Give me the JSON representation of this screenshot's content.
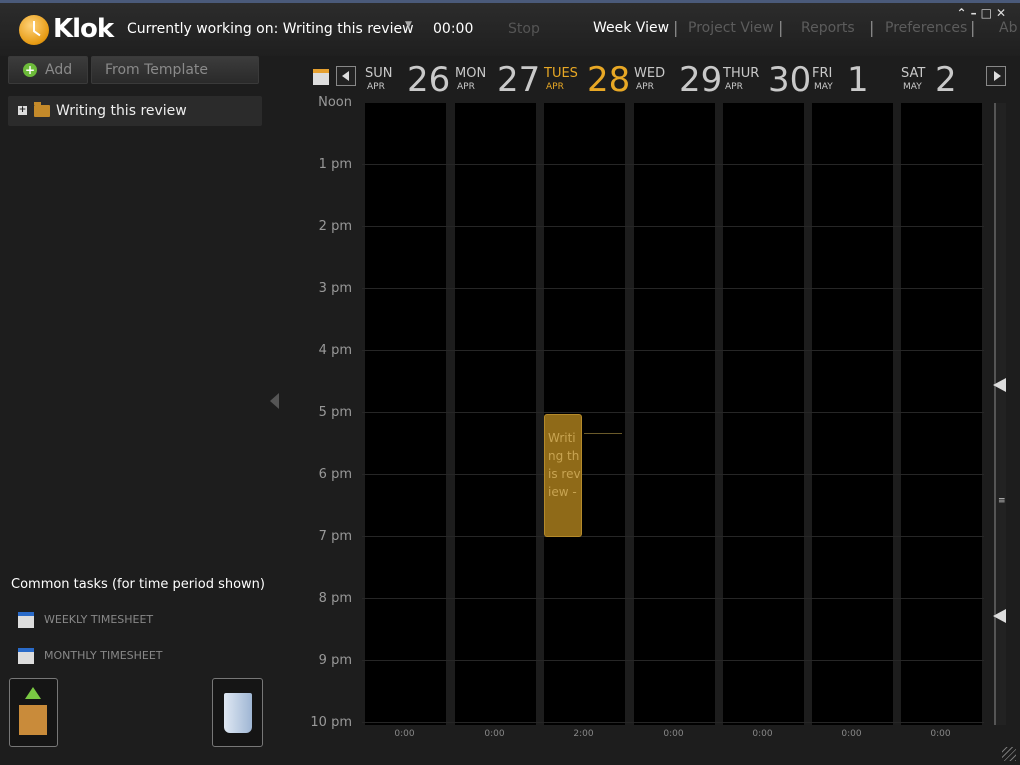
{
  "app": {
    "name": "Klok"
  },
  "header": {
    "working_label": "Currently working on: Writing this review",
    "timer": "00:00",
    "stop_label": "Stop",
    "nav": [
      {
        "label": "Week View",
        "active": true
      },
      {
        "label": "Project View",
        "active": false
      },
      {
        "label": "Reports",
        "active": false
      },
      {
        "label": "Preferences",
        "active": false
      },
      {
        "label": "Ab",
        "active": false
      }
    ]
  },
  "sidebar": {
    "add_label": "Add",
    "template_label": "From Template",
    "projects": [
      {
        "name": "Writing this review"
      }
    ],
    "common_title": "Common tasks (for time period shown)",
    "common_items": [
      {
        "label": "WEEKLY TIMESHEET",
        "icon": "calendar-weekly-icon"
      },
      {
        "label": "MONTHLY TIMESHEET",
        "icon": "calendar-monthly-icon"
      }
    ]
  },
  "calendar": {
    "days": [
      {
        "name": "SUN",
        "month": "APR",
        "num": "26",
        "today": false
      },
      {
        "name": "MON",
        "month": "APR",
        "num": "27",
        "today": false
      },
      {
        "name": "TUES",
        "month": "APR",
        "num": "28",
        "today": true
      },
      {
        "name": "WED",
        "month": "APR",
        "num": "29",
        "today": false
      },
      {
        "name": "THUR",
        "month": "APR",
        "num": "30",
        "today": false
      },
      {
        "name": "FRI",
        "month": "MAY",
        "num": "1",
        "today": false
      },
      {
        "name": "SAT",
        "month": "MAY",
        "num": "2",
        "today": false
      }
    ],
    "times": [
      "Noon",
      "1 pm",
      "2 pm",
      "3 pm",
      "4 pm",
      "5 pm",
      "6 pm",
      "7 pm",
      "8 pm",
      "9 pm",
      "10 pm"
    ],
    "totals": [
      "0:00",
      "0:00",
      "2:00",
      "0:00",
      "0:00",
      "0:00",
      "0:00"
    ],
    "event": {
      "title": "Writing this review -",
      "day": "TUES"
    },
    "colors": {
      "today": "#e8a825",
      "event": "#8f6a18",
      "day_text": "#c9c9c9"
    }
  }
}
